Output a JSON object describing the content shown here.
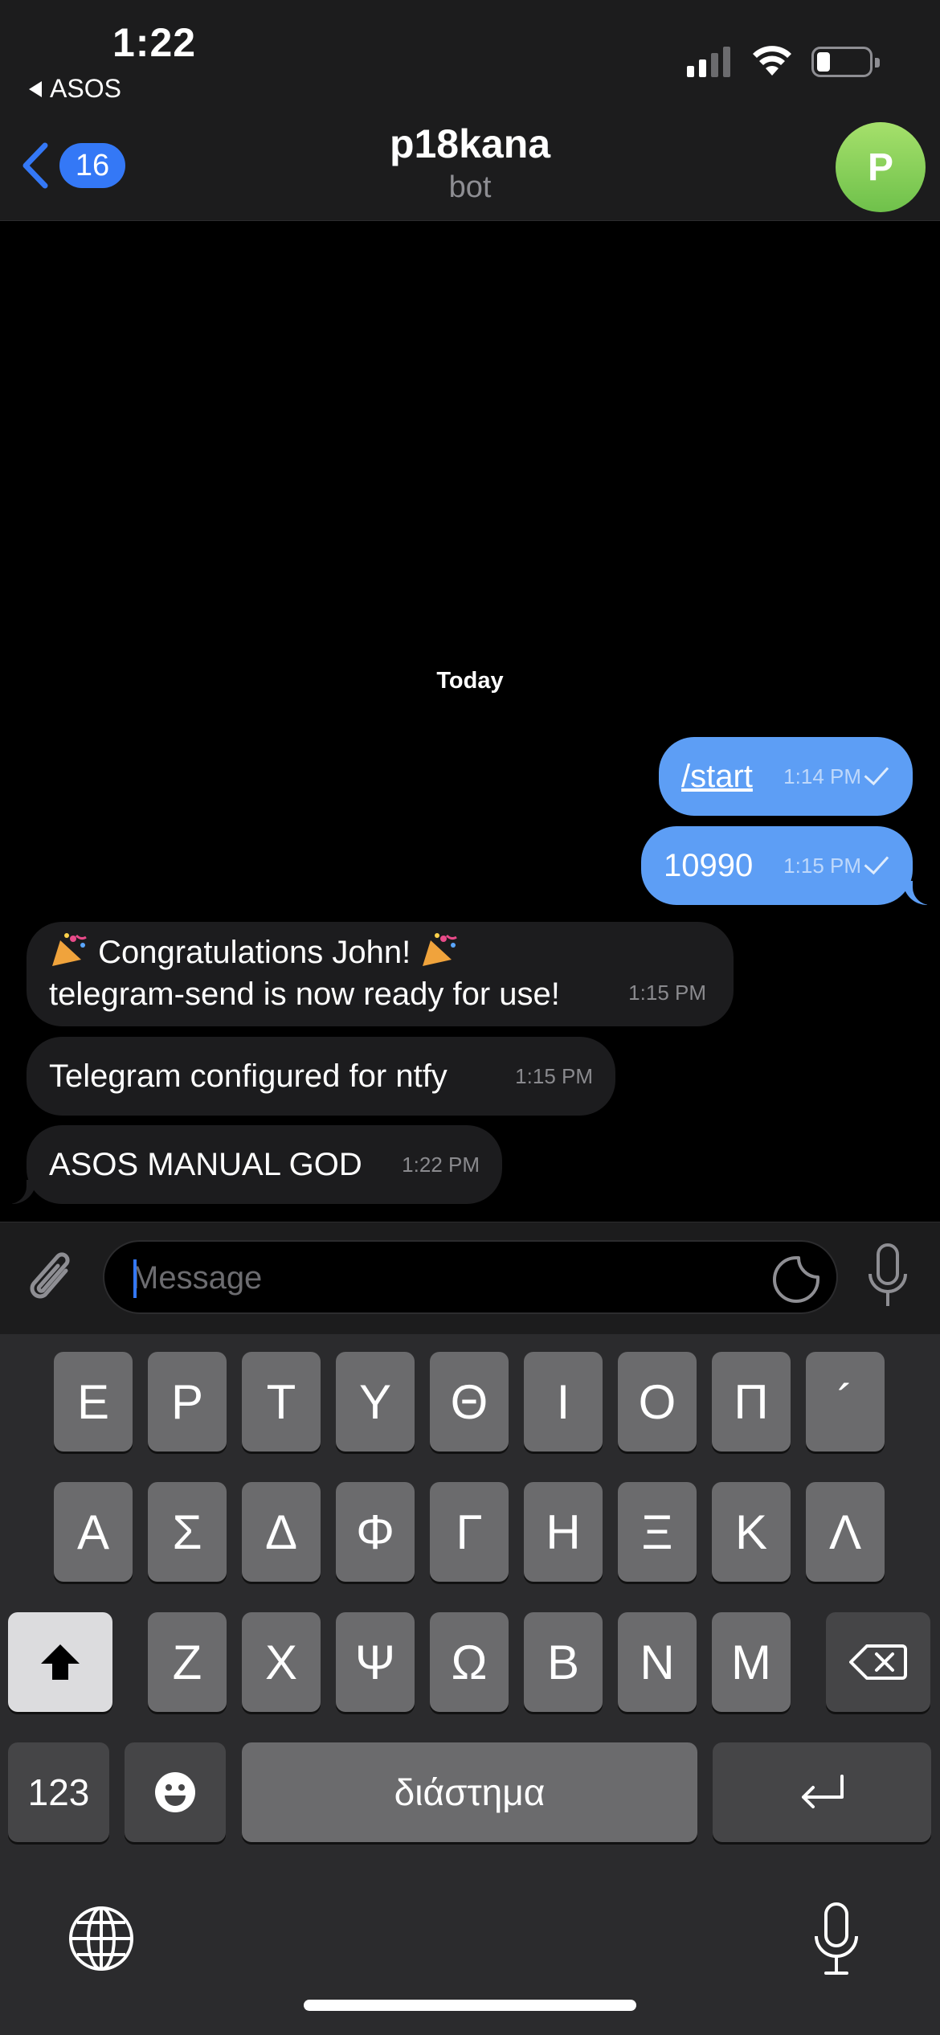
{
  "status_bar": {
    "time": "1:22",
    "back_app": "ASOS"
  },
  "header": {
    "back_badge": "16",
    "title": "p18kana",
    "subtitle": "bot",
    "avatar_letter": "P",
    "avatar_color": "#7dcc55"
  },
  "chat": {
    "day_separator": "Today",
    "messages": [
      {
        "direction": "out",
        "text": "/start",
        "time": "1:14 PM",
        "read": true
      },
      {
        "direction": "out",
        "text": "10990",
        "time": "1:15 PM",
        "read": true
      },
      {
        "direction": "in",
        "line1": "Congratulations John!",
        "line2": "telegram-send is now ready for use!",
        "time": "1:15 PM"
      },
      {
        "direction": "in",
        "text": "Telegram configured for ntfy",
        "time": "1:15 PM"
      },
      {
        "direction": "in",
        "text": "ASOS MANUAL GOD",
        "time": "1:22 PM"
      }
    ]
  },
  "input": {
    "placeholder": "Message"
  },
  "keyboard": {
    "row1": [
      "Ε",
      "Ρ",
      "Τ",
      "Υ",
      "Θ",
      "Ι",
      "Ο",
      "Π",
      "´"
    ],
    "row2": [
      "Α",
      "Σ",
      "Δ",
      "Φ",
      "Γ",
      "Η",
      "Ξ",
      "Κ",
      "Λ"
    ],
    "row3": [
      "Ζ",
      "Χ",
      "Ψ",
      "Ω",
      "Β",
      "Ν",
      "Μ"
    ],
    "numbers_key": "123",
    "space_key": "διάστημα"
  },
  "colors": {
    "outgoing_bubble": "#5d9ef5",
    "incoming_bubble": "#1c1c1e",
    "accent": "#3478f6"
  }
}
